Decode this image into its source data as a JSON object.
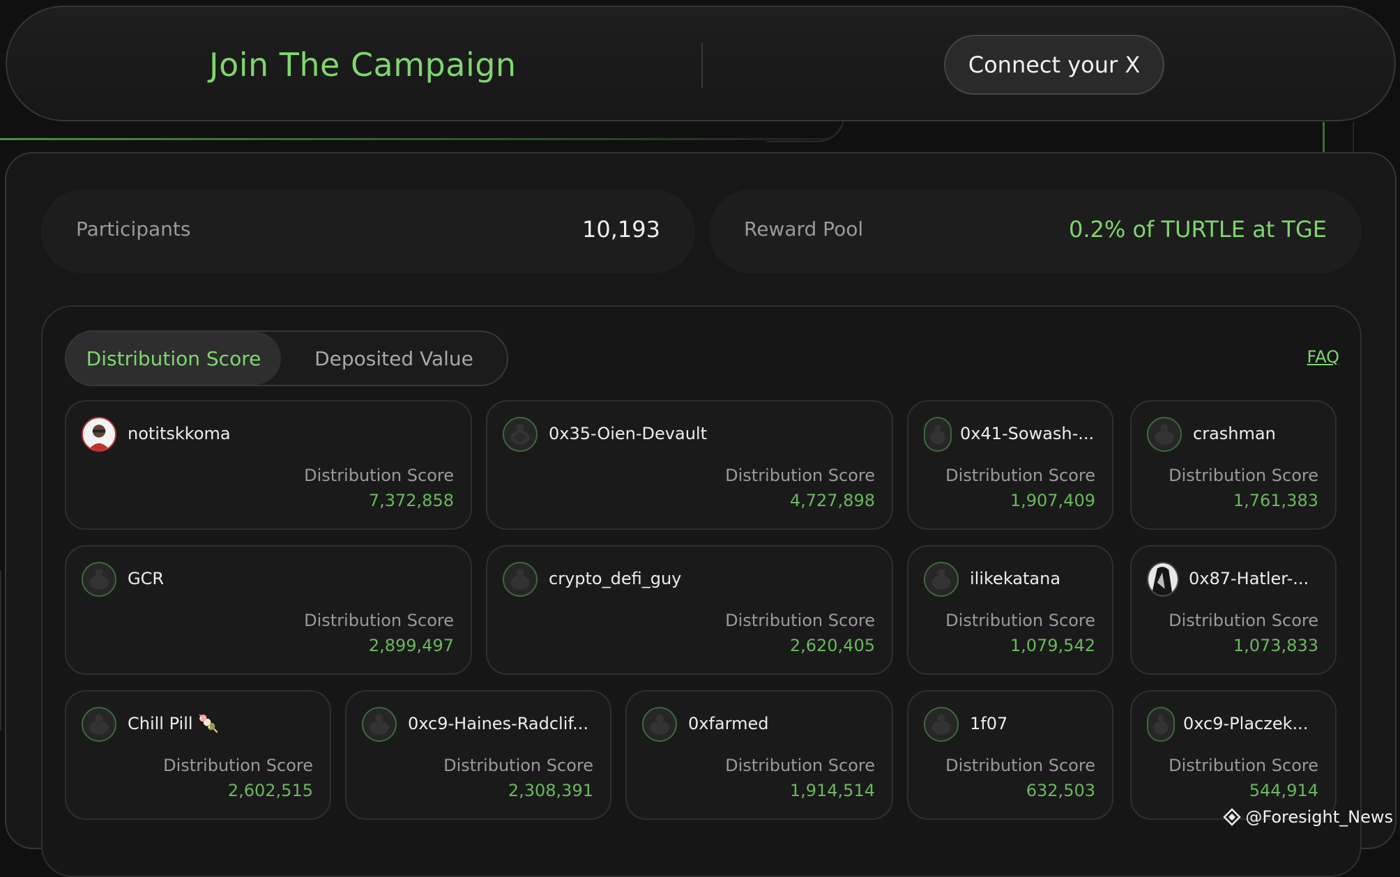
{
  "header": {
    "title": "Join The Campaign",
    "connect_label": "Connect your X"
  },
  "stats": {
    "participants_label": "Participants",
    "participants_value": "10,193",
    "reward_label": "Reward Pool",
    "reward_value": "0.2% of TURTLE at TGE"
  },
  "tabs": {
    "active": "Distribution Score",
    "inactive": "Deposited Value"
  },
  "faq_label": "FAQ",
  "cards": [
    {
      "name": "notitskkoma",
      "label": "Distribution Score",
      "value": "7,372,858"
    },
    {
      "name": "0x35-Oien-Devault",
      "label": "Distribution Score",
      "value": "4,727,898"
    },
    {
      "name": "0x41-Sowash-...",
      "label": "Distribution Score",
      "value": "1,907,409"
    },
    {
      "name": "crashman",
      "label": "Distribution Score",
      "value": "1,761,383"
    },
    {
      "name": "GCR",
      "label": "Distribution Score",
      "value": "2,899,497"
    },
    {
      "name": "crypto_defi_guy",
      "label": "Distribution Score",
      "value": "2,620,405"
    },
    {
      "name": "ilikekatana",
      "label": "Distribution Score",
      "value": "1,079,542"
    },
    {
      "name": "0x87-Hatler-...",
      "label": "Distribution Score",
      "value": "1,073,833"
    },
    {
      "name": "Chill Pill 🍡",
      "label": "Distribution Score",
      "value": "2,602,515"
    },
    {
      "name": "0xc9-Haines-Radclif...",
      "label": "Distribution Score",
      "value": "2,308,391"
    },
    {
      "name": "0xfarmed",
      "label": "Distribution Score",
      "value": "1,914,514"
    },
    {
      "name": "1f07",
      "label": "Distribution Score",
      "value": "632,503"
    },
    {
      "name": "0xc9-Placzek...",
      "label": "Distribution Score",
      "value": "544,914"
    }
  ],
  "watermark": "@Foresight_News",
  "colors": {
    "accent": "#7fd66e",
    "score": "#6ab85d",
    "background": "#101010"
  }
}
